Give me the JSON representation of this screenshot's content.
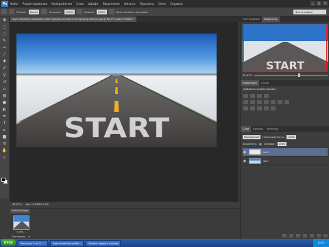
{
  "app": {
    "logo": "Ps"
  },
  "menu": [
    "Файл",
    "Редактирование",
    "Изображение",
    "Слои",
    "Шрифт",
    "Выделение",
    "Фильтр",
    "Просмотр",
    "Окно",
    "Справка"
  ],
  "window_buttons": [
    "_",
    "□",
    "×"
  ],
  "options": {
    "mode_label": "Режим:",
    "mode_value": "Кисть",
    "opacity_label": "Непрозр.:",
    "opacity_value": "100%",
    "flow_label": "Нажим:",
    "flow_value": "100%",
    "restore_label": "Восстановить историю",
    "workspace_value": "Фотография"
  },
  "document": {
    "tab_title": "high-resolution-wallpaper-road-highway-architecture-highway-allbone.jpg @ 66,7% (start, RGB/8) *",
    "road_text": "START"
  },
  "status": {
    "zoom": "66,67%",
    "doc_info": "Док: 5,93M/11,5M"
  },
  "minibridge": {
    "tab": "Мини Bridge",
    "thumb_label": "S-min...",
    "bottom_left": "Постоянно",
    "bottom_right": "▾"
  },
  "right_panels": {
    "nav_tabs": [
      "Гистограмма",
      "Навигатор"
    ],
    "nav_zoom": "66,67%",
    "adj_tabs": [
      "Коррекция",
      "Стили"
    ],
    "adj_subtitle": "Добавить корректировку",
    "layer_tabs": [
      "Слои",
      "Каналы",
      "Контуры"
    ],
    "blend_mode": "Перекрытие",
    "opacity_label": "Непрозрачность:",
    "opacity_value": "100%",
    "lock_label": "Закрепить:",
    "fill_label": "Заливка:",
    "fill_value": "100%",
    "layers": [
      {
        "name": "start",
        "selected": true
      },
      {
        "name": "Фон",
        "selected": false
      }
    ]
  },
  "taskbar": {
    "start": "ПУСК",
    "tasks": [
      "Загрузки 3 из 3 - ...",
      "high-resolution-wallp...",
      "Запись видео с экрана"
    ],
    "clock": "15:51"
  },
  "colors": {
    "selection_frame": "#e02020",
    "sky_top": "#1e5fb8",
    "asphalt": "#4d4a48",
    "center_line": "#f0b020"
  }
}
